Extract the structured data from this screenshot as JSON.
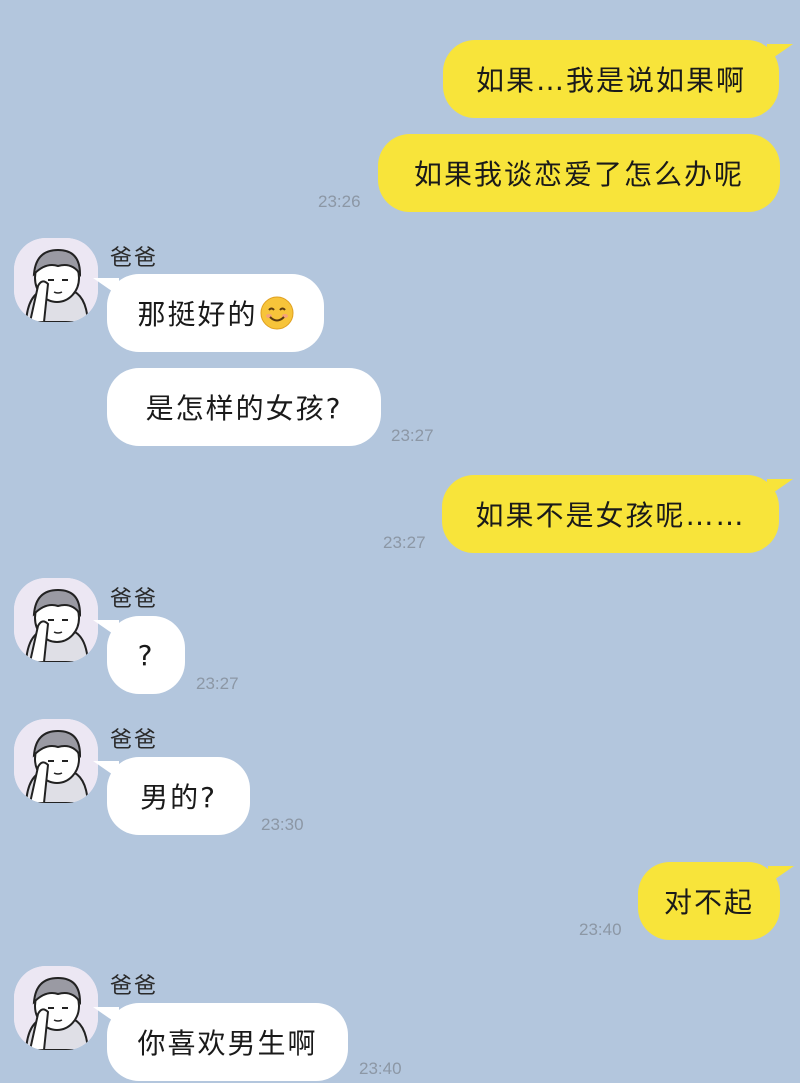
{
  "contact": {
    "name": "爸爸"
  },
  "messages": [
    {
      "text": "如果…我是说如果啊"
    },
    {
      "text": "如果我谈恋爱了怎么办呢",
      "time": "23:26"
    },
    {
      "text": "那挺好的",
      "emoji": "smiling-face-emoji"
    },
    {
      "text": "是怎样的女孩?",
      "time": "23:27"
    },
    {
      "text": "如果不是女孩呢……",
      "time": "23:27"
    },
    {
      "text": "?",
      "time": "23:27"
    },
    {
      "text": "男的?",
      "time": "23:30"
    },
    {
      "text": "对不起",
      "time": "23:40"
    },
    {
      "text": "你喜欢男生啊",
      "time": "23:40"
    }
  ],
  "colors": {
    "background": "#b3c6dd",
    "outgoing_bubble": "#f8e43a",
    "incoming_bubble": "#ffffff",
    "timestamp": "#8c97a5"
  }
}
